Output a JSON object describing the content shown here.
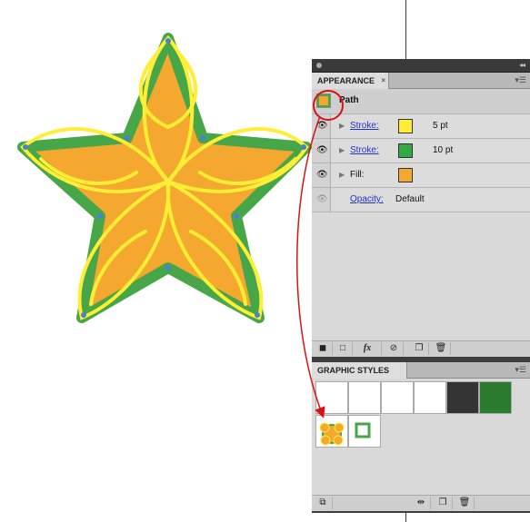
{
  "appearance_panel": {
    "tab_title": "APPEARANCE",
    "path_label": "Path",
    "rows": [
      {
        "label": "Stroke:",
        "value": "5 pt",
        "swatch_color": "#ffee33"
      },
      {
        "label": "Stroke:",
        "value": "10 pt",
        "swatch_color": "#33aa44"
      },
      {
        "label": "Fill:",
        "value": "",
        "swatch_color": "#f4a830"
      },
      {
        "label": "Opacity:",
        "value": "Default"
      }
    ],
    "fx_label": "fx"
  },
  "graphic_styles_panel": {
    "tab_title": "GRAPHIC STYLES"
  },
  "colors": {
    "star_fill": "#f4a830",
    "stroke_green": "#46a648",
    "stroke_yellow": "#ffee33",
    "highlight_red": "#dd1111",
    "anchor_blue": "#4a7fd8"
  }
}
